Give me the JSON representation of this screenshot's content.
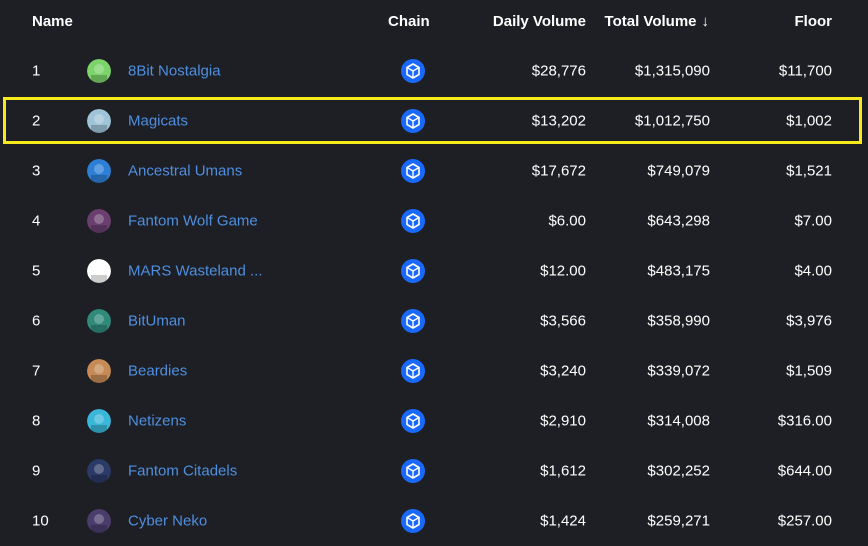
{
  "header": {
    "name_label": "Name",
    "chain_label": "Chain",
    "daily_volume_label": "Daily Volume",
    "total_volume_label": "Total Volume",
    "sort_indicator": "↓",
    "floor_label": "Floor"
  },
  "colors": {
    "background": "#1e1f25",
    "link": "#4d8fe0",
    "chain_badge": "#1969ff",
    "highlight": "#f6ea1c"
  },
  "rows": [
    {
      "rank": "1",
      "name": "8Bit Nostalgia",
      "chain_icon": "fantom-icon",
      "daily": "$28,776",
      "total": "$1,315,090",
      "floor": "$11,700",
      "avatar_color": "#7bd36a",
      "highlighted": false
    },
    {
      "rank": "2",
      "name": "Magicats",
      "chain_icon": "fantom-icon",
      "daily": "$13,202",
      "total": "$1,012,750",
      "floor": "$1,002",
      "avatar_color": "#9fc4d8",
      "highlighted": true
    },
    {
      "rank": "3",
      "name": "Ancestral Umans",
      "chain_icon": "fantom-icon",
      "daily": "$17,672",
      "total": "$749,079",
      "floor": "$1,521",
      "avatar_color": "#2d7fd6",
      "highlighted": false
    },
    {
      "rank": "4",
      "name": "Fantom Wolf Game",
      "chain_icon": "fantom-icon",
      "daily": "$6.00",
      "total": "$643,298",
      "floor": "$7.00",
      "avatar_color": "#6a3e6e",
      "highlighted": false
    },
    {
      "rank": "5",
      "name": "MARS Wasteland ...",
      "chain_icon": "fantom-icon",
      "daily": "$12.00",
      "total": "$483,175",
      "floor": "$4.00",
      "avatar_color": "#ffffff",
      "highlighted": false
    },
    {
      "rank": "6",
      "name": "BitUman",
      "chain_icon": "fantom-icon",
      "daily": "$3,566",
      "total": "$358,990",
      "floor": "$3,976",
      "avatar_color": "#2f8a7a",
      "highlighted": false
    },
    {
      "rank": "7",
      "name": "Beardies",
      "chain_icon": "fantom-icon",
      "daily": "$3,240",
      "total": "$339,072",
      "floor": "$1,509",
      "avatar_color": "#c58a55",
      "highlighted": false
    },
    {
      "rank": "8",
      "name": "Netizens",
      "chain_icon": "fantom-icon",
      "daily": "$2,910",
      "total": "$314,008",
      "floor": "$316.00",
      "avatar_color": "#3ab6d8",
      "highlighted": false
    },
    {
      "rank": "9",
      "name": "Fantom Citadels",
      "chain_icon": "fantom-icon",
      "daily": "$1,612",
      "total": "$302,252",
      "floor": "$644.00",
      "avatar_color": "#2b3a66",
      "highlighted": false
    },
    {
      "rank": "10",
      "name": "Cyber Neko",
      "chain_icon": "fantom-icon",
      "daily": "$1,424",
      "total": "$259,271",
      "floor": "$257.00",
      "avatar_color": "#4a3d6b",
      "highlighted": false
    }
  ]
}
